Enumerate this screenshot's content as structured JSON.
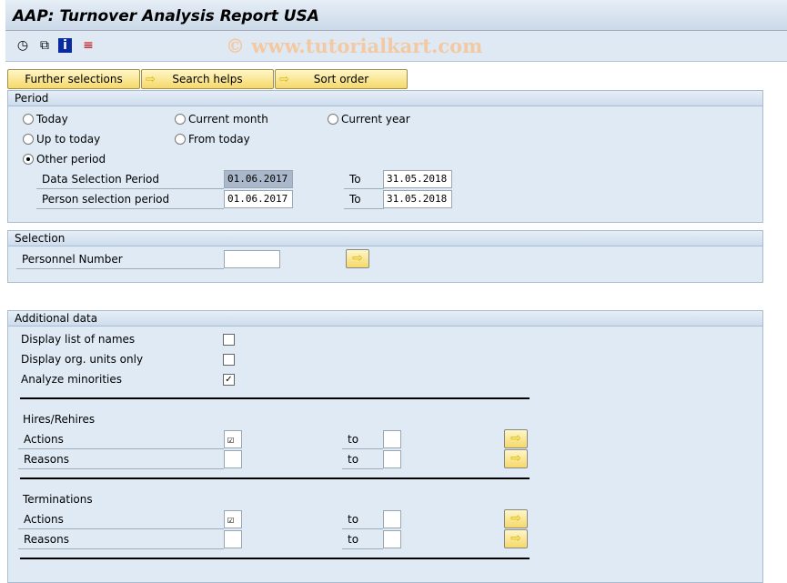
{
  "title": "AAP: Turnover Analysis Report USA",
  "watermark": "© www.tutorialkart.com",
  "toolbar": {
    "icons": [
      "execute-clock-icon",
      "variant-copy-icon",
      "info-icon",
      "program-doc-icon"
    ]
  },
  "buttons": {
    "further": "Further selections",
    "search": "Search helps",
    "sort": "Sort order"
  },
  "period": {
    "header": "Period",
    "today": "Today",
    "current_month": "Current month",
    "current_year": "Current year",
    "up_to_today": "Up to today",
    "from_today": "From today",
    "other": "Other period",
    "selected": "Other period",
    "data_sel_label": "Data Selection Period",
    "data_from": "01.06.2017",
    "data_to": "31.05.2018",
    "person_sel_label": "Person selection period",
    "person_from": "01.06.2017",
    "person_to": "31.05.2018",
    "to_label": "To"
  },
  "selection": {
    "header": "Selection",
    "pernr_label": "Personnel Number",
    "pernr_value": ""
  },
  "additional": {
    "header": "Additional data",
    "list_names": {
      "label": "Display list of names",
      "checked": false
    },
    "org_units": {
      "label": "Display org. units only",
      "checked": false
    },
    "minorities": {
      "label": "Analyze minorities",
      "checked": true
    },
    "hires_header": "Hires/Rehires",
    "term_header": "Terminations",
    "actions_label": "Actions",
    "reasons_label": "Reasons",
    "to_label": "to",
    "actions_value": "☑"
  }
}
